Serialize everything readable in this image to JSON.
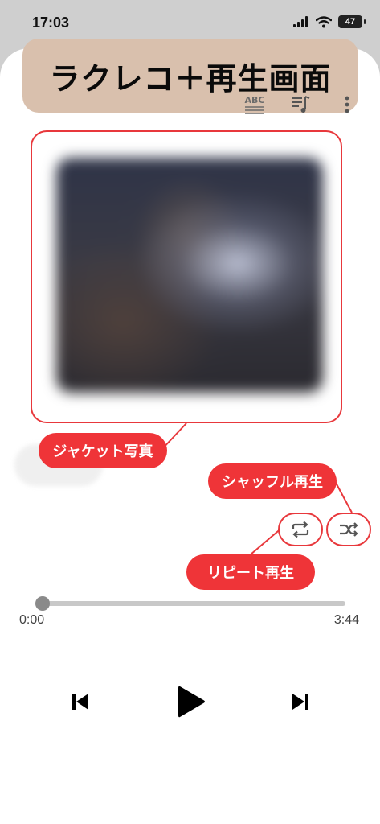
{
  "status_bar": {
    "time": "17:03",
    "battery": "47"
  },
  "header": {
    "banner_title": "ラクレコ＋再生画面"
  },
  "icons": {
    "lyrics": "lyrics-abc-icon",
    "queue": "queue-music-icon",
    "more": "more-vertical-icon",
    "repeat": "repeat-icon",
    "shuffle": "shuffle-icon",
    "previous": "skip-previous-icon",
    "play": "play-icon",
    "next": "skip-next-icon"
  },
  "annotations": {
    "jacket_label": "ジャケット写真",
    "shuffle_label": "シャッフル再生",
    "repeat_label": "リピート再生"
  },
  "player": {
    "elapsed": "0:00",
    "duration": "3:44",
    "progress": 0
  },
  "colors": {
    "annotation_red": "#ef3438",
    "banner_bg": "#d9c0ad"
  }
}
